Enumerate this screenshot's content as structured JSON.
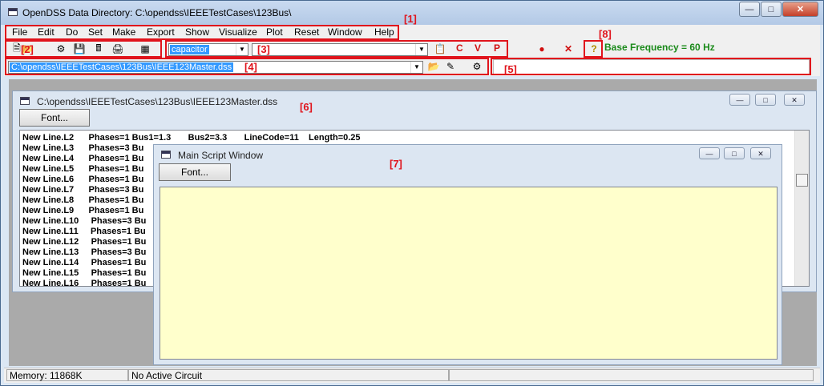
{
  "window": {
    "title": "OpenDSS Data Directory: C:\\opendss\\IEEETestCases\\123Bus\\"
  },
  "menu": [
    "File",
    "Edit",
    "Do",
    "Set",
    "Make",
    "Export",
    "Show",
    "Visualize",
    "Plot",
    "Reset",
    "Window",
    "Help"
  ],
  "toolbar": {
    "class_combo_value": "capacitor",
    "file_combo_value": "C:\\opendss\\IEEETestCases\\123Bus\\IEEE123Master.dss",
    "c_label": "C",
    "v_label": "V",
    "p_label": "P",
    "base_frequency": "Base Frequency = 60 Hz"
  },
  "callouts": [
    "[1]",
    "[2]",
    "[3]",
    "[4]",
    "[5]",
    "[6]",
    "[7]",
    "[8]"
  ],
  "editor_window": {
    "title": "C:\\opendss\\IEEETestCases\\123Bus\\IEEE123Master.dss",
    "font_button": "Font...",
    "lines": [
      "New Line.L2      Phases=1 Bus1=1.3       Bus2=3.3       LineCode=11    Length=0.25",
      "New Line.L3      Phases=3 Bu",
      "New Line.L4      Phases=1 Bu",
      "New Line.L5      Phases=1 Bu",
      "New Line.L6      Phases=1 Bu",
      "New Line.L7      Phases=3 Bu",
      "New Line.L8      Phases=1 Bu",
      "New Line.L9      Phases=1 Bu",
      "New Line.L10     Phases=3 Bu",
      "New Line.L11     Phases=1 Bu",
      "New Line.L12     Phases=1 Bu",
      "New Line.L13     Phases=3 Bu",
      "New Line.L14     Phases=1 Bu",
      "New Line.L15     Phases=1 Bu",
      "New Line.L16     Phases=1 Bu"
    ]
  },
  "script_window": {
    "title": "Main Script Window",
    "font_button": "Font..."
  },
  "status": {
    "memory": "Memory: 11868K",
    "circuit": "No Active Circuit"
  },
  "colors": {
    "accent": "#3399ff",
    "callout": "#e0141c",
    "script_bg": "#ffffcc",
    "base_freq": "#1a8a1a"
  }
}
